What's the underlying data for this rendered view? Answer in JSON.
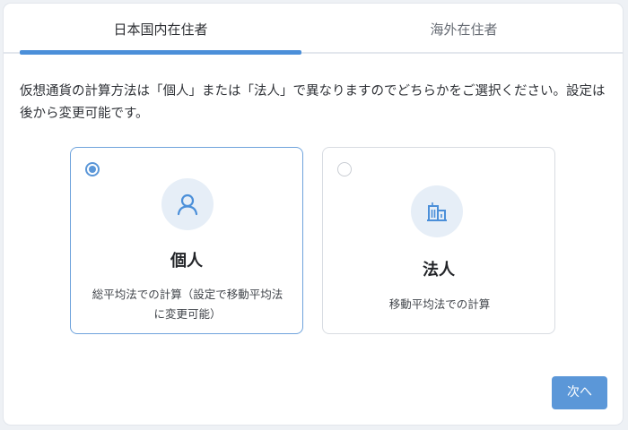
{
  "tabs": [
    {
      "label": "日本国内在住者",
      "active": true
    },
    {
      "label": "海外在住者",
      "active": false
    }
  ],
  "description": "仮想通貨の計算方法は「個人」または「法人」で異なりますのでどちらかをご選択ください。設定は後から変更可能です。",
  "options": [
    {
      "title": "個人",
      "description": "総平均法での計算（設定で移動平均法に変更可能）",
      "selected": true,
      "icon": "person-icon"
    },
    {
      "title": "法人",
      "description": "移動平均法での計算",
      "selected": false,
      "icon": "building-icon"
    }
  ],
  "next_button": {
    "label": "次へ"
  },
  "colors": {
    "accent": "#5b97d8",
    "tab_indicator": "#4b8fd9",
    "icon_bg": "#e6eef7"
  }
}
